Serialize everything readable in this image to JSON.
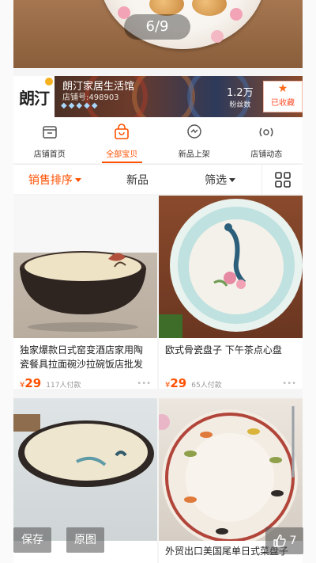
{
  "gallery": {
    "pager": "6/9"
  },
  "shop": {
    "logo_text": "朗汀",
    "name": "朗汀家居生活馆",
    "id_text": "店铺号:498903",
    "rating_icons": [
      "diamond-icon",
      "diamond-icon",
      "diamond-icon",
      "diamond-icon",
      "diamond-icon"
    ],
    "fans_count": "1.2万",
    "fans_label": "粉丝数",
    "fav_label": "已收藏"
  },
  "tabs": [
    {
      "label": "店铺首页",
      "icon": "store-icon"
    },
    {
      "label": "全部宝贝",
      "icon": "bag-icon",
      "active": true
    },
    {
      "label": "新品上架",
      "icon": "new-bubble-icon"
    },
    {
      "label": "店铺动态",
      "icon": "broadcast-icon"
    }
  ],
  "sort": {
    "sales": "销售排序",
    "new": "新品",
    "filter": "筛选"
  },
  "products": [
    {
      "title": "独家爆款日式窑变酒店家用陶瓷餐具拉面碗沙拉碗饭店批发",
      "currency": "¥",
      "price": "29",
      "sold": "117人付款"
    },
    {
      "title": "欧式骨瓷盘子 下午茶点心盘",
      "currency": "¥",
      "price": "29",
      "sold": "65人付款"
    },
    {
      "title": "",
      "currency": "",
      "price": "",
      "sold": ""
    },
    {
      "title": "外贸出口美国尾单日式菜盘子",
      "currency": "",
      "price": "",
      "sold": ""
    }
  ],
  "overlay": {
    "save": "保存",
    "original": "原图",
    "like_count": "7"
  },
  "colors": {
    "accent": "#ff5000"
  }
}
